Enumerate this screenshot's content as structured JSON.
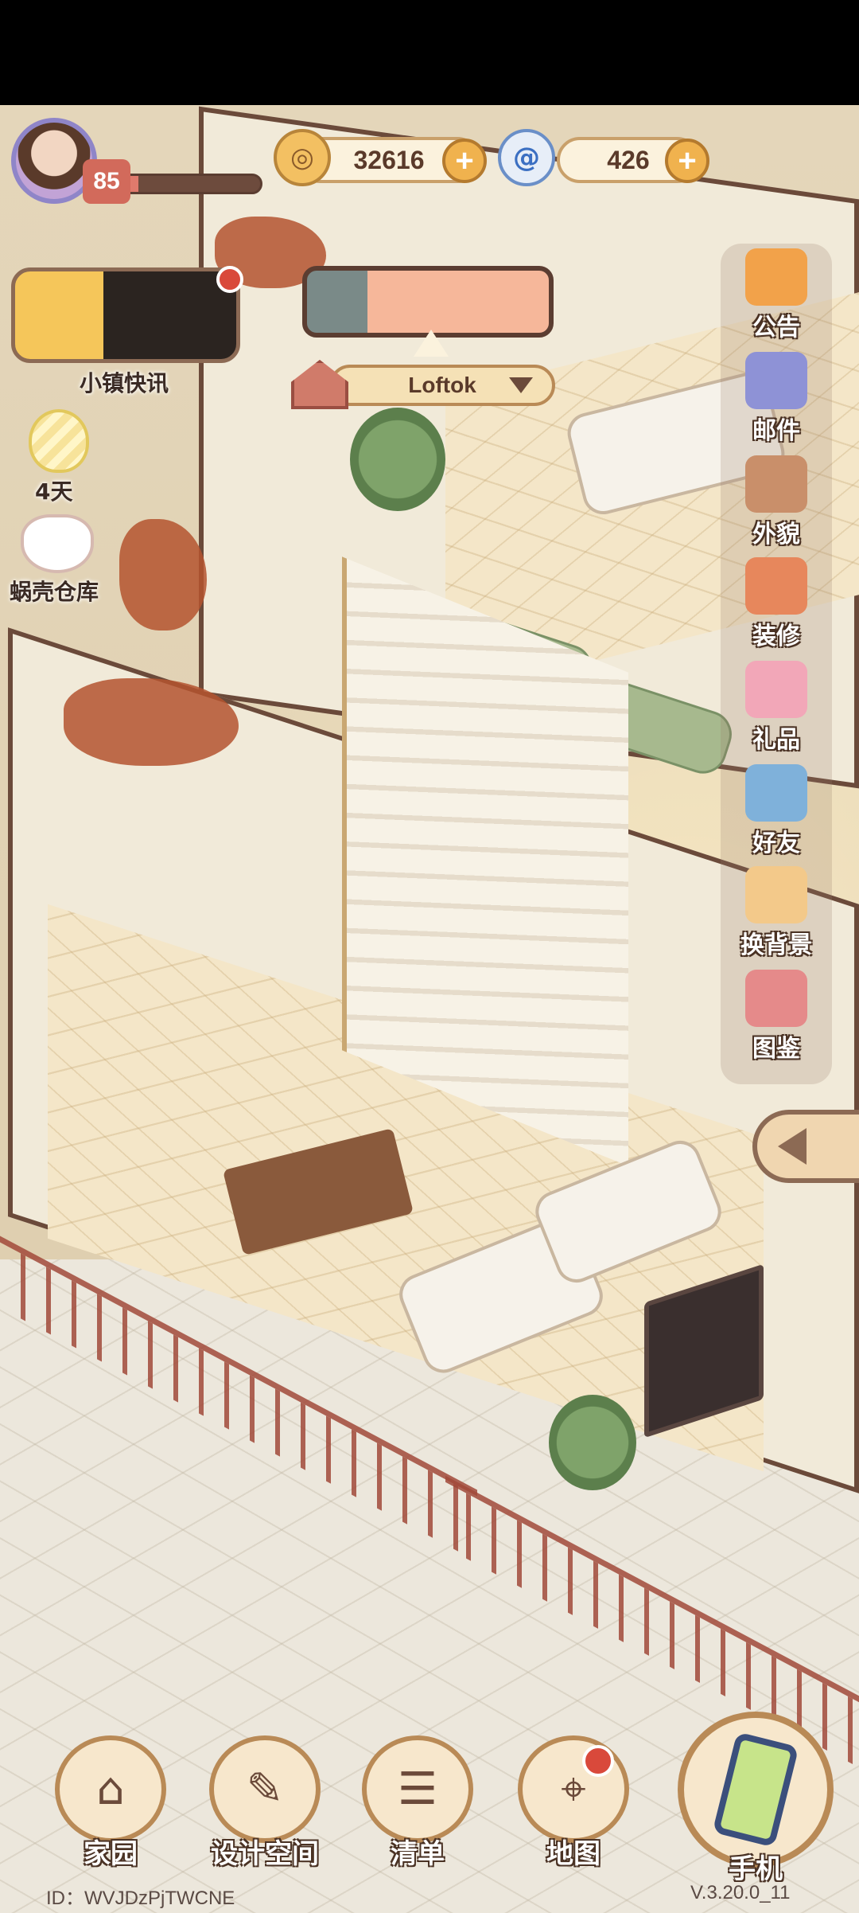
{
  "player": {
    "level": "85",
    "xp_fraction": 0.12
  },
  "currencies": [
    {
      "name": "coins",
      "icon": "coin-icon",
      "value": "32616"
    },
    {
      "name": "shells",
      "icon": "swirl-shell-icon",
      "value": "426"
    }
  ],
  "left_menu": {
    "news_label": "小镇快讯",
    "egg_label": "4天",
    "storage_label": "蜗壳仓库"
  },
  "location": {
    "name": "Loftok"
  },
  "side_menu": [
    {
      "label": "公告",
      "icon": "announcement-icon",
      "color": "#f2a24a"
    },
    {
      "label": "邮件",
      "icon": "mail-icon",
      "color": "#8e92d6"
    },
    {
      "label": "外貌",
      "icon": "appearance-icon",
      "color": "#c98f6a"
    },
    {
      "label": "装修",
      "icon": "decorate-icon",
      "color": "#e7875c"
    },
    {
      "label": "礼品",
      "icon": "gift-icon",
      "color": "#f2a7b8"
    },
    {
      "label": "好友",
      "icon": "friends-icon",
      "color": "#7fb1da"
    },
    {
      "label": "换背景",
      "icon": "background-icon",
      "color": "#f3c98a"
    },
    {
      "label": "图鉴",
      "icon": "catalog-icon",
      "color": "#e58a8a"
    }
  ],
  "bottom_nav": [
    {
      "label": "家园",
      "icon": "home-icon",
      "glyph": "⌂"
    },
    {
      "label": "设计空间",
      "icon": "design-space-icon",
      "glyph": "✎"
    },
    {
      "label": "清单",
      "icon": "list-icon",
      "glyph": "☰"
    },
    {
      "label": "地图",
      "icon": "map-pin-icon",
      "glyph": "⌖"
    }
  ],
  "phone": {
    "label": "手机"
  },
  "footer": {
    "id": "ID：WVJDzPjTWCNE",
    "version": "V.3.20.0_11"
  }
}
